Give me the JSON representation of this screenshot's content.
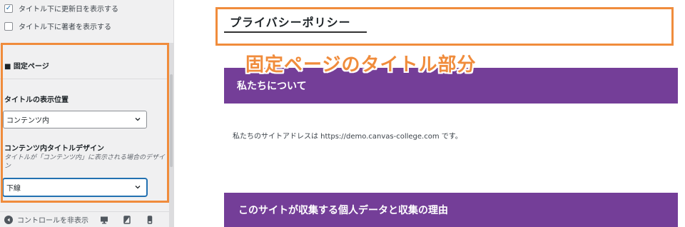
{
  "sidebar": {
    "checkboxes": [
      {
        "label": "タイトル下に更新日を表示する",
        "checked": true
      },
      {
        "label": "タイトル下に著者を表示する",
        "checked": false
      }
    ],
    "section_title": "■ 固定ページ",
    "title_position": {
      "label": "タイトルの表示位置",
      "value": "コンテンツ内"
    },
    "content_title_design": {
      "label": "コンテンツ内タイトルデザイン",
      "description": "タイトルが「コンテンツ内」に表示される場合のデザイン",
      "value": "下線"
    },
    "footer": {
      "hide_controls_label": "コントロールを非表示"
    }
  },
  "preview": {
    "page_title": "プライバシーポリシー",
    "annotation": "固定ページのタイトル部分",
    "sections": [
      {
        "heading": "私たちについて",
        "body": "私たちのサイトアドレスは https://demo.canvas-college.com です。"
      },
      {
        "heading": "このサイトが収集する個人データと収集の理由"
      }
    ]
  },
  "colors": {
    "accent_orange": "#f08c3c",
    "heading_purple": "#743e98",
    "focus_blue": "#2271b1"
  },
  "icons": [
    "checkbox-icon",
    "chevron-down-icon",
    "hide-controls-icon",
    "desktop-icon",
    "tablet-icon",
    "mobile-icon"
  ]
}
